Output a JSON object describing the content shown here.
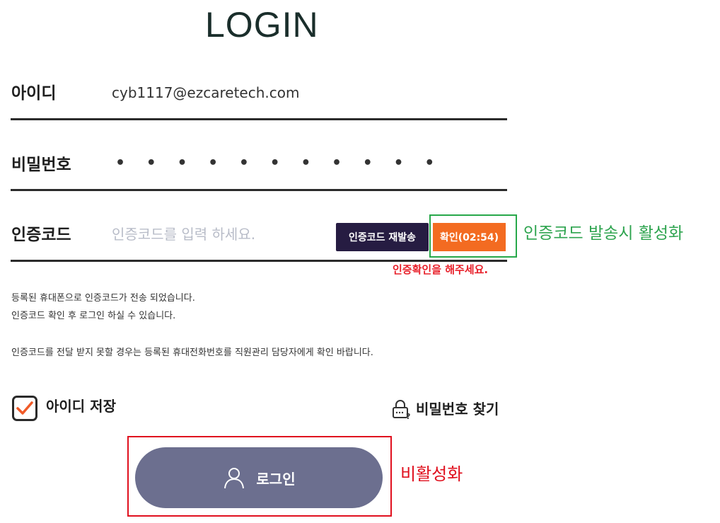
{
  "page": {
    "title": "LOGIN"
  },
  "form": {
    "id": {
      "label": "아이디",
      "value": "cyb1117@ezcaretech.com"
    },
    "password": {
      "label": "비밀번호",
      "value": "• • • • • • • • • • •"
    },
    "auth_code": {
      "label": "인증코드",
      "placeholder": "인증코드를 입력 하세요.",
      "resend_label": "인증코드 재발송",
      "confirm_label": "확인(02:54)",
      "warning": "인증확인을 해주세요."
    }
  },
  "info": {
    "line1": "등록된 휴대폰으로 인증코드가 전송 되었습니다.",
    "line2": "인증코드 확인 후 로그인 하실 수 있습니다.",
    "line3": "인증코드를 전달 받지 못할 경우는 등록된 휴대전화번호를 직원관리 담당자에게 확인 바랍니다."
  },
  "options": {
    "save_id_label": "아이디 저장",
    "save_id_checked": true,
    "find_password_label": "비밀번호 찾기"
  },
  "login_button": {
    "label": "로그인",
    "enabled": false,
    "icon": "user-icon"
  },
  "annotations": {
    "confirm_note": "인증코드 발송시 활성화",
    "login_note": "비활성화"
  },
  "colors": {
    "resend_bg": "#261c42",
    "confirm_bg": "#f36b21",
    "login_bg": "#6c6f8f",
    "annotation_green": "#2ea44f",
    "annotation_red": "#e0101e"
  }
}
